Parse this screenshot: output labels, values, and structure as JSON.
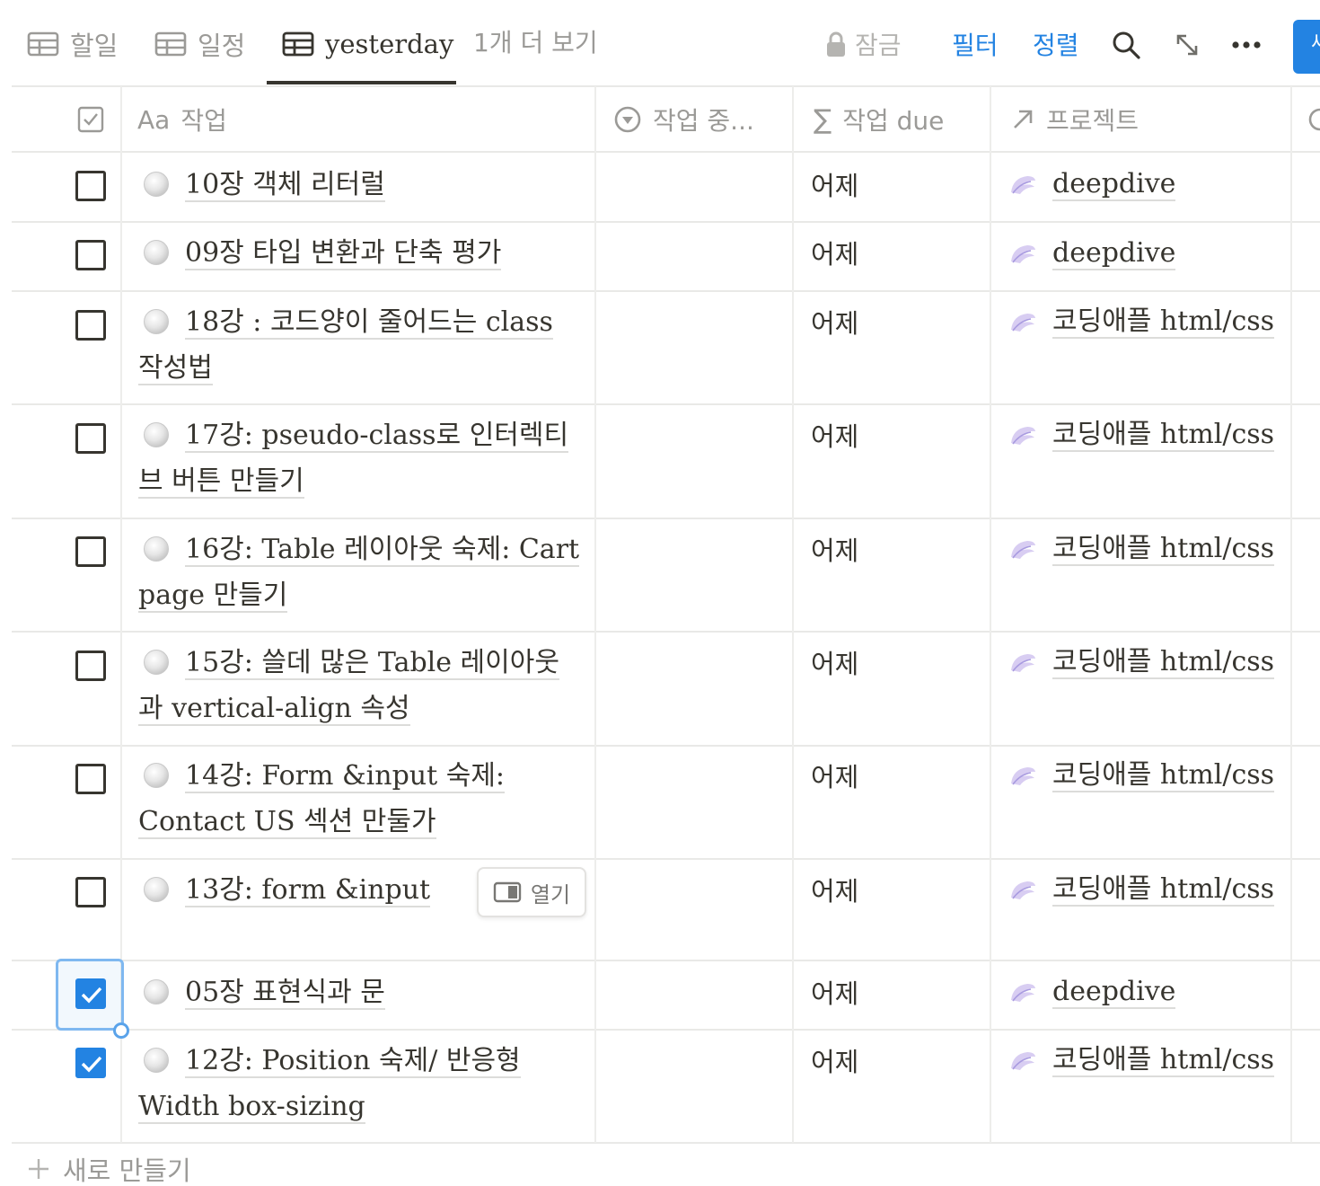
{
  "views": {
    "tabs": [
      {
        "label": "할일",
        "icon": "table-icon",
        "active": false
      },
      {
        "label": "일정",
        "icon": "table-icon",
        "active": false
      },
      {
        "label": "yesterday",
        "icon": "table-icon",
        "active": true
      }
    ],
    "more_label": "1개 더 보기"
  },
  "toolbar": {
    "lock_label": "잠금",
    "filter_label": "필터",
    "sort_label": "정렬",
    "new_label": "새"
  },
  "columns": {
    "task": {
      "icon_text": "Aa",
      "label": "작업"
    },
    "status": {
      "label": "작업 중..."
    },
    "due": {
      "label": "작업 due"
    },
    "project": {
      "label": "프로젝트"
    }
  },
  "rows": [
    {
      "checked": false,
      "title": "10장 객체 리터럴",
      "due": "어제",
      "project": "deepdive"
    },
    {
      "checked": false,
      "title": "09장 타입 변환과 단축 평가",
      "due": "어제",
      "project": "deepdive"
    },
    {
      "checked": false,
      "title": "18강 : 코드양이 줄어드는 class 작성법",
      "due": "어제",
      "project": "코딩애플 html/css"
    },
    {
      "checked": false,
      "title": "17강: pseudo-class로 인터렉티브 버튼 만들기",
      "due": "어제",
      "project": "코딩애플 html/css"
    },
    {
      "checked": false,
      "title": "16강: Table 레이아웃 숙제: Cart page 만들기",
      "due": "어제",
      "project": "코딩애플 html/css"
    },
    {
      "checked": false,
      "title": "15강: 쓸데 많은 Table 레이아웃과 vertical-align 속성",
      "due": "어제",
      "project": "코딩애플 html/css"
    },
    {
      "checked": false,
      "title": "14강: Form &input 숙제: Contact US 섹션 만둘가",
      "due": "어제",
      "project": "코딩애플 html/css"
    },
    {
      "checked": false,
      "title": "13강: form &input",
      "due": "어제",
      "project": "코딩애플 html/css",
      "open_label": "열기"
    },
    {
      "checked": true,
      "title": "05장 표현식과 문",
      "due": "어제",
      "project": "deepdive"
    },
    {
      "checked": true,
      "title": "12강: Position 숙제/ 반응형 Width box-sizing",
      "due": "어제",
      "project": "코딩애플 html/css"
    }
  ],
  "add_row_label": "새로 만들기",
  "colors": {
    "accent": "#2383e2",
    "text": "#37352f",
    "muted": "#9b9a97",
    "divider": "#e9e9e7"
  }
}
